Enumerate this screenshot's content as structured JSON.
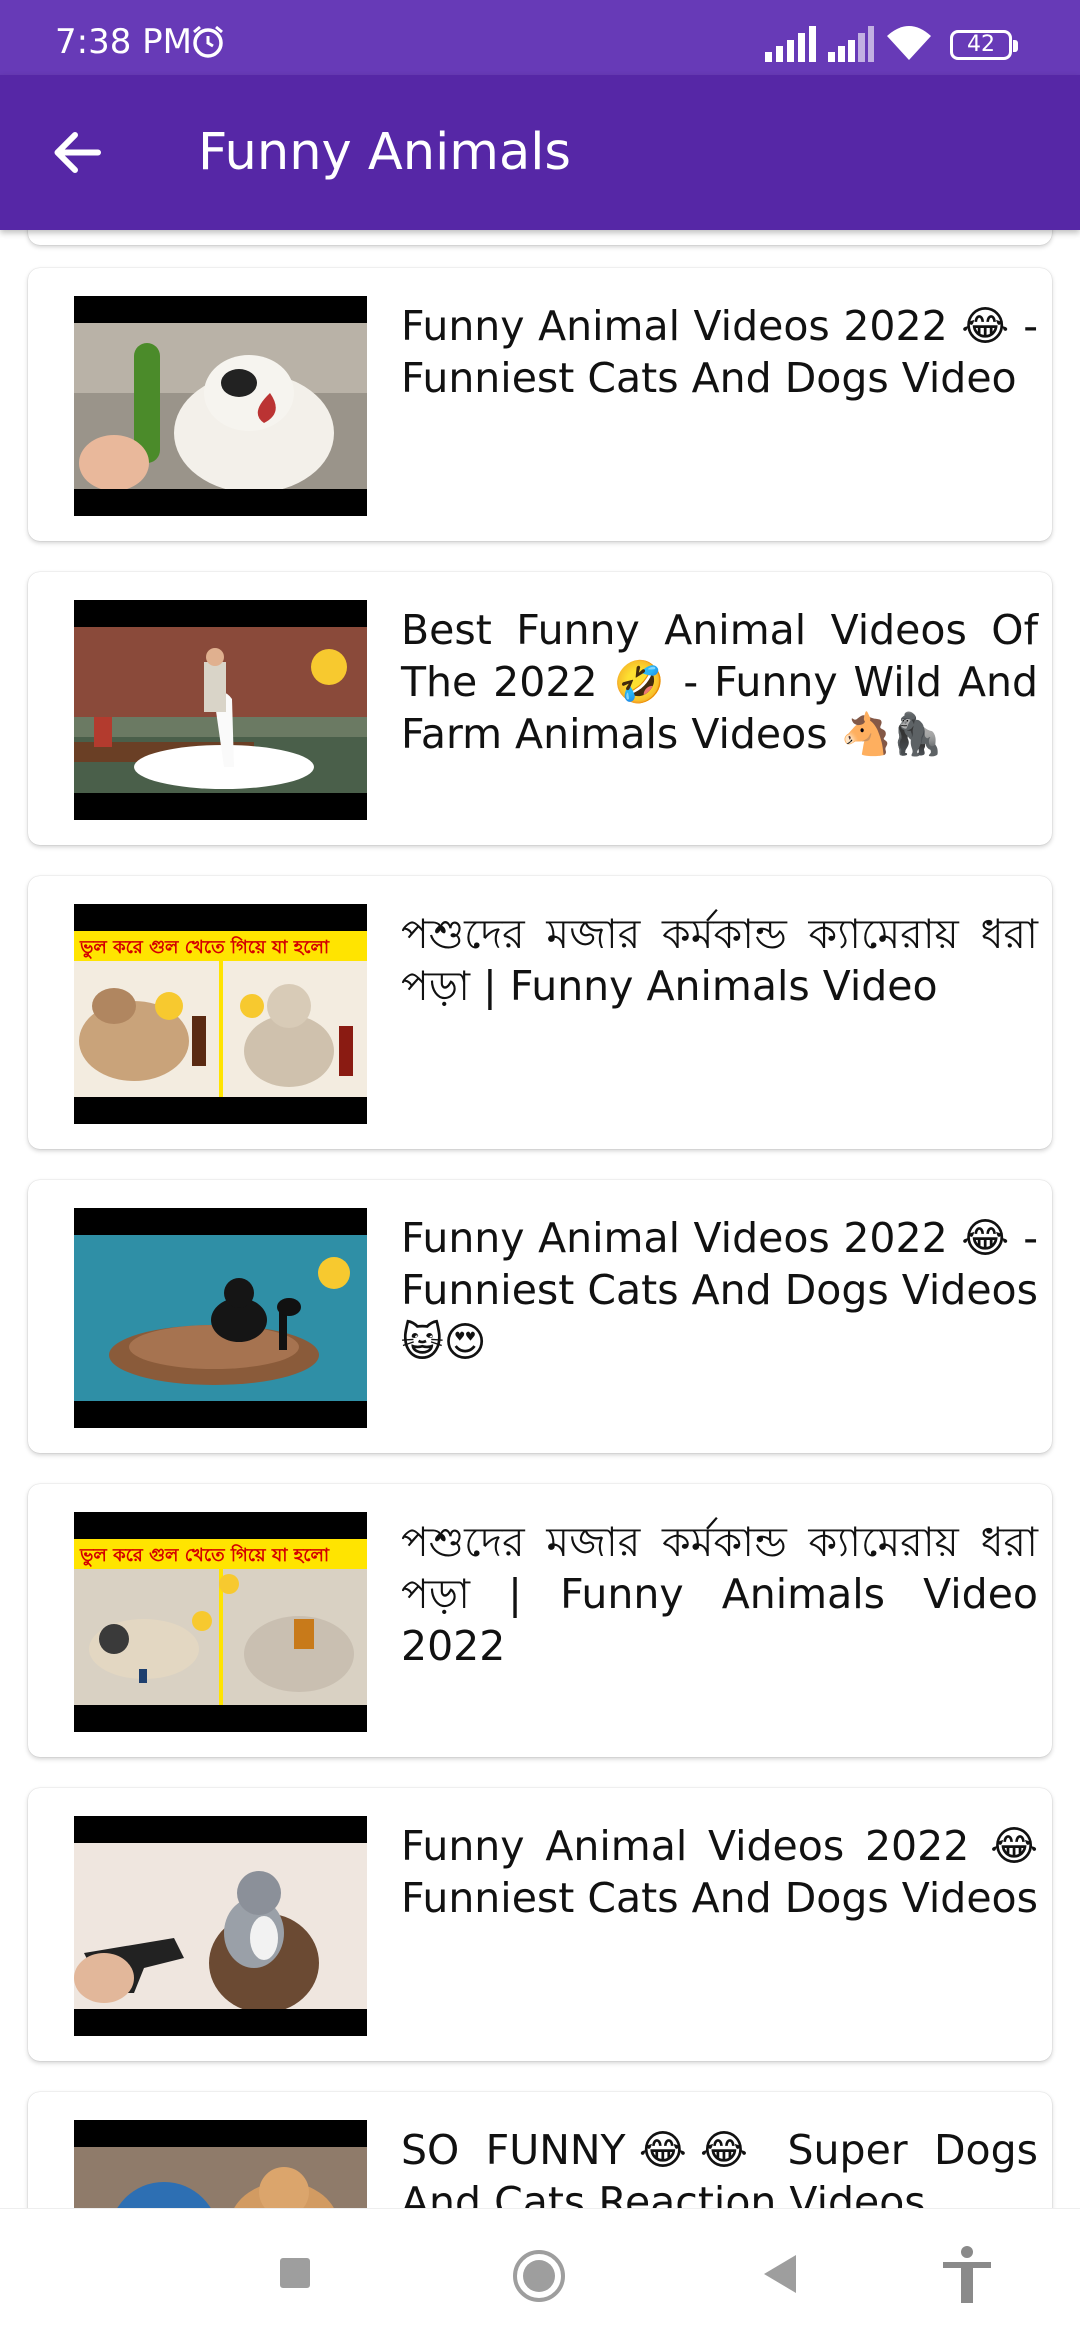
{
  "status_bar": {
    "time": "7:38 PM",
    "battery": "42"
  },
  "app_bar": {
    "title": "Funny Animals"
  },
  "videos": [
    {
      "title": "Funny Animal Videos 2022 😂 - Funniest Cats And Dogs Video"
    },
    {
      "title": "Best Funny Animal Videos Of The 2022 🤣 - Funny Wild And Farm Animals Videos 🐴🦍"
    },
    {
      "title": "পশুদের মজার কর্মকান্ড ক্যামেরায় ধরা পড়া | Funny Animals Video",
      "banner": "ভুল করে গুল খেতে গিয়ে যা হলো"
    },
    {
      "title": "Funny Animal Videos 2022 😂 - Funniest Cats And Dogs Videos 😺😍"
    },
    {
      "title": "পশুদের মজার কর্মকান্ড ক্যামেরায় ধরা পড়া | Funny Animals Video 2022",
      "banner": "ভুল করে গুল খেতে গিয়ে যা হলো"
    },
    {
      "title": "Funny Animal Videos 2022 😂 Funniest Cats And Dogs Videos"
    },
    {
      "title": "SO FUNNY😂😂 Super Dogs And Cats Reaction Videos"
    }
  ],
  "colors": {
    "status_bar": "#673ab7",
    "app_bar": "#5627a6"
  },
  "icons": {
    "back": "arrow-left-icon",
    "nav": [
      "square-icon",
      "home-circle-icon",
      "back-triangle-icon",
      "accessibility-icon"
    ]
  }
}
